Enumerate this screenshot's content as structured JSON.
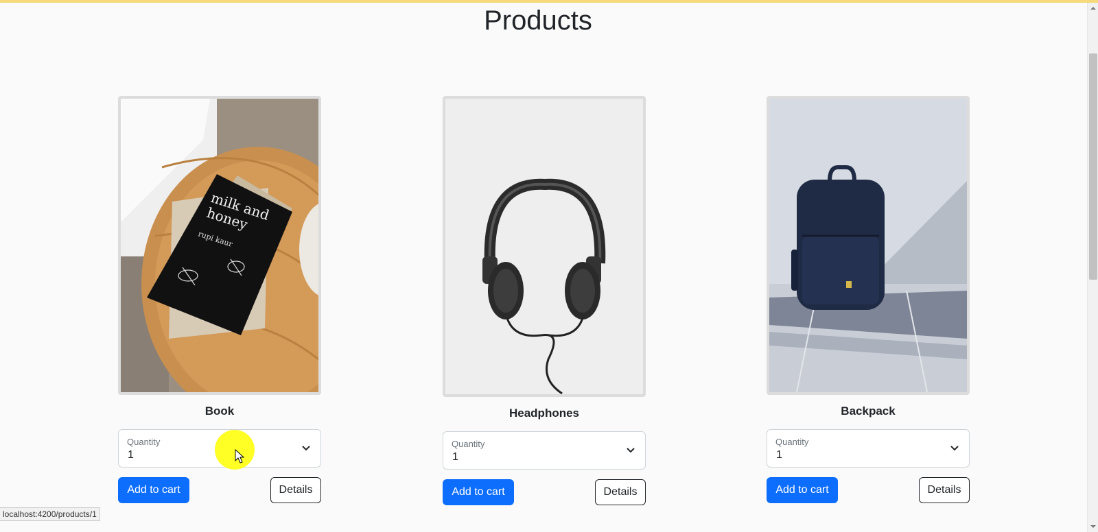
{
  "page": {
    "title": "Products"
  },
  "products": [
    {
      "name": "Book",
      "quantity_label": "Quantity",
      "quantity_value": "1",
      "add_label": "Add to cart",
      "details_label": "Details",
      "image": "book-photo"
    },
    {
      "name": "Headphones",
      "quantity_label": "Quantity",
      "quantity_value": "1",
      "add_label": "Add to cart",
      "details_label": "Details",
      "image": "headphones-photo"
    },
    {
      "name": "Backpack",
      "quantity_label": "Quantity",
      "quantity_value": "1",
      "add_label": "Add to cart",
      "details_label": "Details",
      "image": "backpack-photo"
    }
  ],
  "book_cover": {
    "title_line1": "milk and",
    "title_line2": "honey",
    "author": "rupi kaur"
  },
  "status": {
    "url": "localhost:4200/products/1"
  },
  "colors": {
    "primary": "#0d6efd",
    "accent_bar": "#f5d97a",
    "highlight": "#ffff00"
  }
}
